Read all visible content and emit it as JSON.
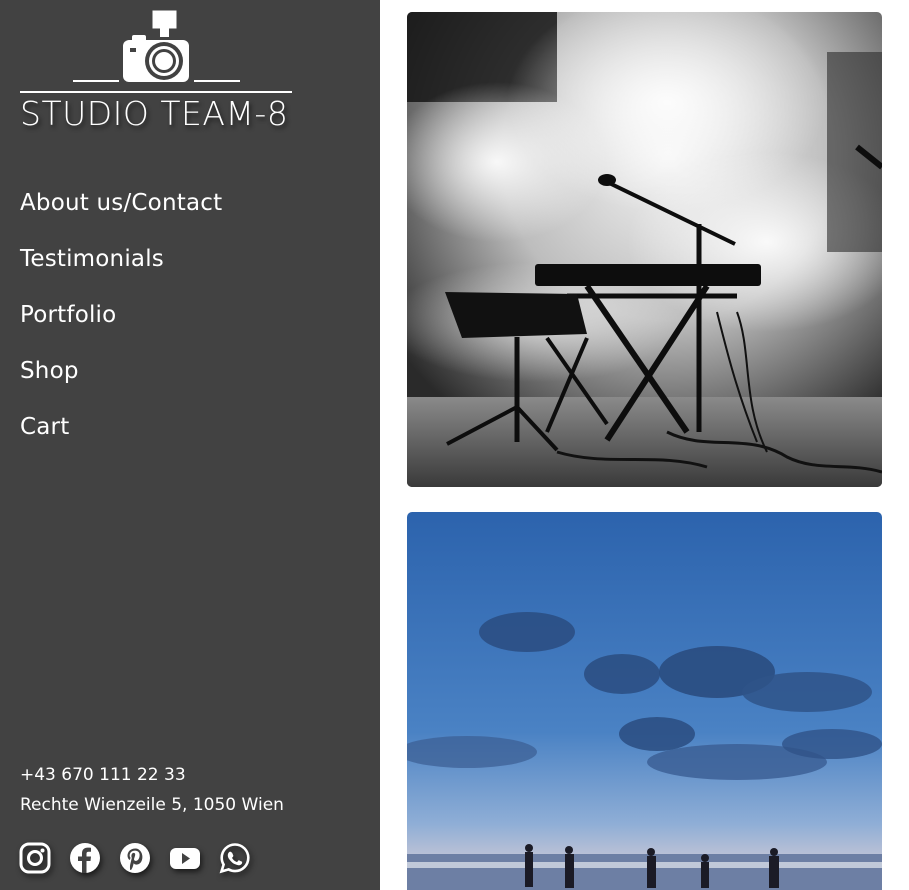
{
  "brand": {
    "name": "STUDIO TEAM-8",
    "logo_icon": "camera-icon"
  },
  "nav": {
    "items": [
      {
        "label": "About us/Contact"
      },
      {
        "label": "Testimonials"
      },
      {
        "label": "Portfolio"
      },
      {
        "label": "Shop"
      },
      {
        "label": "Cart"
      }
    ]
  },
  "contact": {
    "phone": "+43 670 111 22 33",
    "address": "Rechte Wienzeile 5, 1050 Wien"
  },
  "social": {
    "icons": [
      "instagram-icon",
      "facebook-icon",
      "pinterest-icon",
      "youtube-icon",
      "whatsapp-icon"
    ]
  },
  "colors": {
    "sidebar_bg": "#424242",
    "text": "#ffffff",
    "page_bg": "#ffffff"
  },
  "gallery": {
    "images": [
      {
        "subject": "black-and-white stage with keyboard, microphone stand and smoke"
      },
      {
        "subject": "blue evening sky with clouds over a beach with people"
      }
    ]
  }
}
